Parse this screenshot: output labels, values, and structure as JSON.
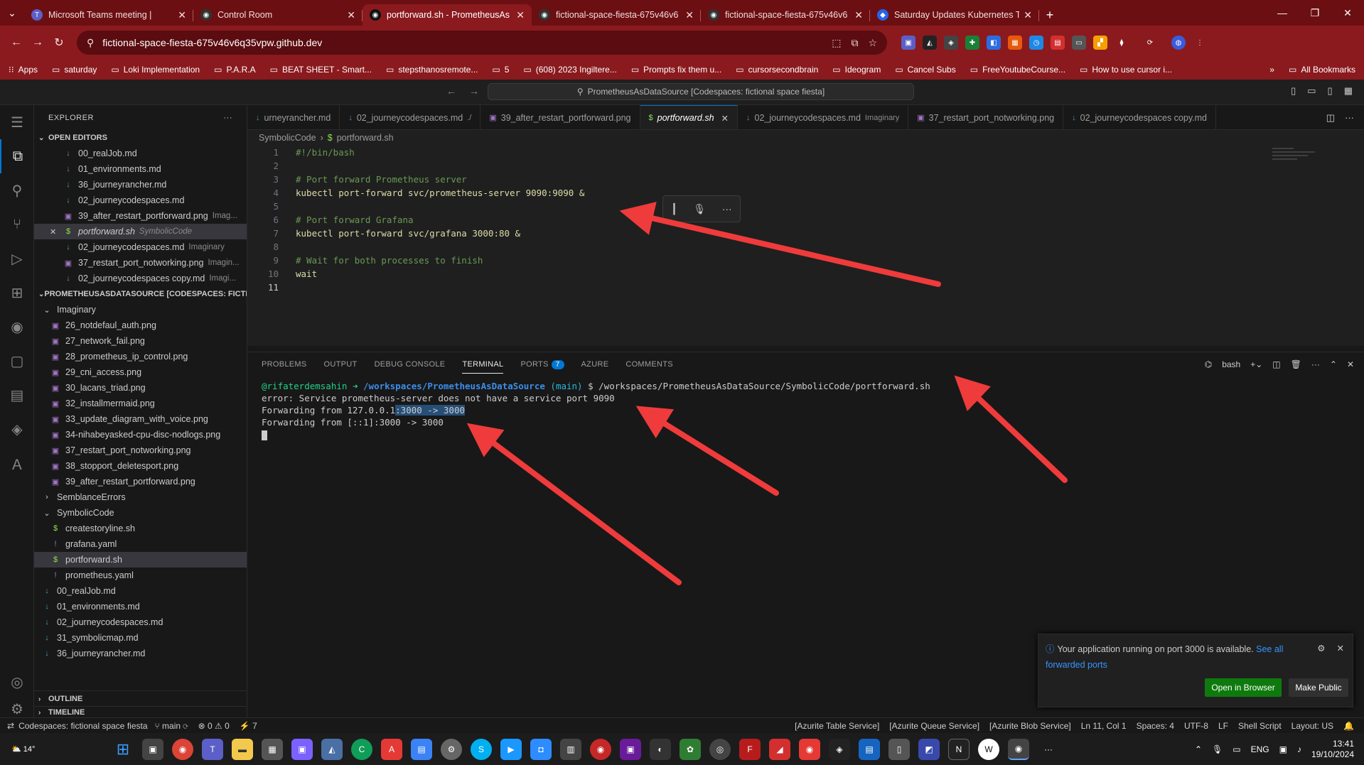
{
  "browser": {
    "tabs": [
      {
        "title": "Microsoft Teams meeting | ",
        "fav_color": "#5b5fc7",
        "fav": "T",
        "active": false
      },
      {
        "title": "Control Room",
        "fav_color": "#333",
        "fav": "◉",
        "active": false
      },
      {
        "title": "portforward.sh - PrometheusAs",
        "fav_color": "#111",
        "fav": "◉",
        "active": true
      },
      {
        "title": "fictional-space-fiesta-675v46v6",
        "fav_color": "#333",
        "fav": "◉",
        "active": false
      },
      {
        "title": "fictional-space-fiesta-675v46v6",
        "fav_color": "#333",
        "fav": "◉",
        "active": false
      },
      {
        "title": "Saturday Updates Kubernetes Tr",
        "fav_color": "#2563eb",
        "fav": "◆",
        "active": false
      }
    ],
    "url": "fictional-space-fiesta-675v46v6q35vpw.github.dev",
    "bookmarks": [
      "Apps",
      "saturday",
      "Loki Implementation",
      "P.A.R.A",
      "BEAT SHEET - Smart...",
      "stepsthanosremote...",
      "5",
      "(608) 2023 Ingiltere...",
      "Prompts fix them u...",
      "cursorsecondbrain",
      "Ideogram",
      "Cancel Subs",
      "FreeYoutubeCourse...",
      "How to use cursor i..."
    ],
    "all_bookmarks": "All Bookmarks"
  },
  "vscode": {
    "command_center": "PrometheusAsDataSource [Codespaces: fictional space fiesta]",
    "explorer_title": "EXPLORER",
    "open_editors_title": "OPEN EDITORS",
    "open_editors": [
      {
        "name": "00_realJob.md",
        "type": "md",
        "desc": ""
      },
      {
        "name": "01_environments.md",
        "type": "md",
        "desc": ""
      },
      {
        "name": "36_journeyrancher.md",
        "type": "md",
        "desc": ""
      },
      {
        "name": "02_journeycodespaces.md",
        "type": "md",
        "desc": ""
      },
      {
        "name": "39_after_restart_portforward.png",
        "type": "png",
        "desc": "Imag..."
      },
      {
        "name": "portforward.sh",
        "type": "sh",
        "desc": "SymbolicCode",
        "selected": true
      },
      {
        "name": "02_journeycodespaces.md",
        "type": "md",
        "desc": "Imaginary"
      },
      {
        "name": "37_restart_port_notworking.png",
        "type": "png",
        "desc": "Imagin..."
      },
      {
        "name": "02_journeycodespaces copy.md",
        "type": "md",
        "desc": "Imagi..."
      }
    ],
    "workspace_title": "PROMETHEUSASDATASOURCE [CODESPACES: FICTI...",
    "tree": [
      {
        "name": "Imaginary",
        "kind": "folder-open",
        "depth": 1
      },
      {
        "name": "26_notdefaul_auth.png",
        "kind": "png",
        "depth": 2
      },
      {
        "name": "27_network_fail.png",
        "kind": "png",
        "depth": 2
      },
      {
        "name": "28_prometheus_ip_control.png",
        "kind": "png",
        "depth": 2
      },
      {
        "name": "29_cni_access.png",
        "kind": "png",
        "depth": 2
      },
      {
        "name": "30_lacans_triad.png",
        "kind": "png",
        "depth": 2
      },
      {
        "name": "32_installmermaid.png",
        "kind": "png",
        "depth": 2
      },
      {
        "name": "33_update_diagram_with_voice.png",
        "kind": "png",
        "depth": 2
      },
      {
        "name": "34-nihabeyasked-cpu-disc-nodlogs.png",
        "kind": "png",
        "depth": 2
      },
      {
        "name": "37_restart_port_notworking.png",
        "kind": "png",
        "depth": 2
      },
      {
        "name": "38_stopport_deletesport.png",
        "kind": "png",
        "depth": 2
      },
      {
        "name": "39_after_restart_portforward.png",
        "kind": "png",
        "depth": 2
      },
      {
        "name": "SemblanceErrors",
        "kind": "folder",
        "depth": 1
      },
      {
        "name": "SymbolicCode",
        "kind": "folder-open",
        "depth": 1
      },
      {
        "name": "createstoryline.sh",
        "kind": "sh",
        "depth": 2
      },
      {
        "name": "grafana.yaml",
        "kind": "yaml",
        "depth": 2
      },
      {
        "name": "portforward.sh",
        "kind": "sh",
        "depth": 2,
        "selected": true
      },
      {
        "name": "prometheus.yaml",
        "kind": "yaml",
        "depth": 2
      },
      {
        "name": "00_realJob.md",
        "kind": "md",
        "depth": 1
      },
      {
        "name": "01_environments.md",
        "kind": "md",
        "depth": 1
      },
      {
        "name": "02_journeycodespaces.md",
        "kind": "md",
        "depth": 1
      },
      {
        "name": "31_symbolicmap.md",
        "kind": "md",
        "depth": 1
      },
      {
        "name": "36_journeyrancher.md",
        "kind": "md",
        "depth": 1
      }
    ],
    "outline_title": "OUTLINE",
    "timeline_title": "TIMELINE",
    "editor_tabs": [
      {
        "name": "urneyrancher.md",
        "type": "md",
        "desc": ""
      },
      {
        "name": "02_journeycodespaces.md",
        "type": "md",
        "desc": "./"
      },
      {
        "name": "39_after_restart_portforward.png",
        "type": "png",
        "desc": ""
      },
      {
        "name": "portforward.sh",
        "type": "sh",
        "desc": "",
        "active": true
      },
      {
        "name": "02_journeycodespaces.md",
        "type": "md",
        "desc": "Imaginary"
      },
      {
        "name": "37_restart_port_notworking.png",
        "type": "png",
        "desc": ""
      },
      {
        "name": "02_journeycodespaces copy.md",
        "type": "md",
        "desc": ""
      }
    ],
    "breadcrumb": [
      "SymbolicCode",
      "portforward.sh"
    ],
    "code_lines": [
      {
        "n": "1",
        "text": "#!/bin/bash",
        "kind": "cmt"
      },
      {
        "n": "2",
        "text": "",
        "kind": ""
      },
      {
        "n": "3",
        "text": "# Port forward Prometheus server",
        "kind": "cmt"
      },
      {
        "n": "4",
        "text": "kubectl port-forward svc/prometheus-server 9090:9090 &",
        "kind": "cmd"
      },
      {
        "n": "5",
        "text": "",
        "kind": ""
      },
      {
        "n": "6",
        "text": "# Port forward Grafana",
        "kind": "cmt"
      },
      {
        "n": "7",
        "text": "kubectl port-forward svc/grafana 3000:80 &",
        "kind": "cmd"
      },
      {
        "n": "8",
        "text": "",
        "kind": ""
      },
      {
        "n": "9",
        "text": "# Wait for both processes to finish",
        "kind": "cmt"
      },
      {
        "n": "10",
        "text": "wait",
        "kind": "kw"
      },
      {
        "n": "11",
        "text": "",
        "kind": "",
        "current": true
      }
    ],
    "panel_tabs": [
      "PROBLEMS",
      "OUTPUT",
      "DEBUG CONSOLE",
      "TERMINAL",
      "PORTS",
      "AZURE",
      "COMMENTS"
    ],
    "ports_badge": "7",
    "terminal_shell": "bash",
    "terminal": {
      "user": "@rifaterdemsahin",
      "arrow": "➜",
      "path": "/workspaces/PrometheusAsDataSource",
      "branch": "(main)",
      "command": "$ /workspaces/PrometheusAsDataSource/SymbolicCode/portforward.sh",
      "line2": "error: Service prometheus-server does not have a service port 9090",
      "line3_pre": "Forwarding from 127.0.0.1",
      "line3_hl": ":3000 -> 3000",
      "line4": "Forwarding from [::1]:3000 -> 3000"
    },
    "notification": {
      "message": "Your application running on port 3000 is available.",
      "link": "See all forwarded ports",
      "open_browser": "Open in Browser",
      "make_public": "Make Public"
    },
    "status": {
      "remote": "Codespaces: fictional space fiesta",
      "branch": "main",
      "errors": "0",
      "warnings": "0",
      "ports": "7",
      "right": [
        "[Azurite Table Service]",
        "[Azurite Queue Service]",
        "[Azurite Blob Service]",
        "Ln 11, Col 1",
        "Spaces: 4",
        "UTF-8",
        "LF",
        "Shell Script",
        "Layout: US"
      ]
    }
  },
  "taskbar": {
    "weather": "14°",
    "lang": "ENG",
    "time": "13:41",
    "date": "19/10/2024"
  }
}
